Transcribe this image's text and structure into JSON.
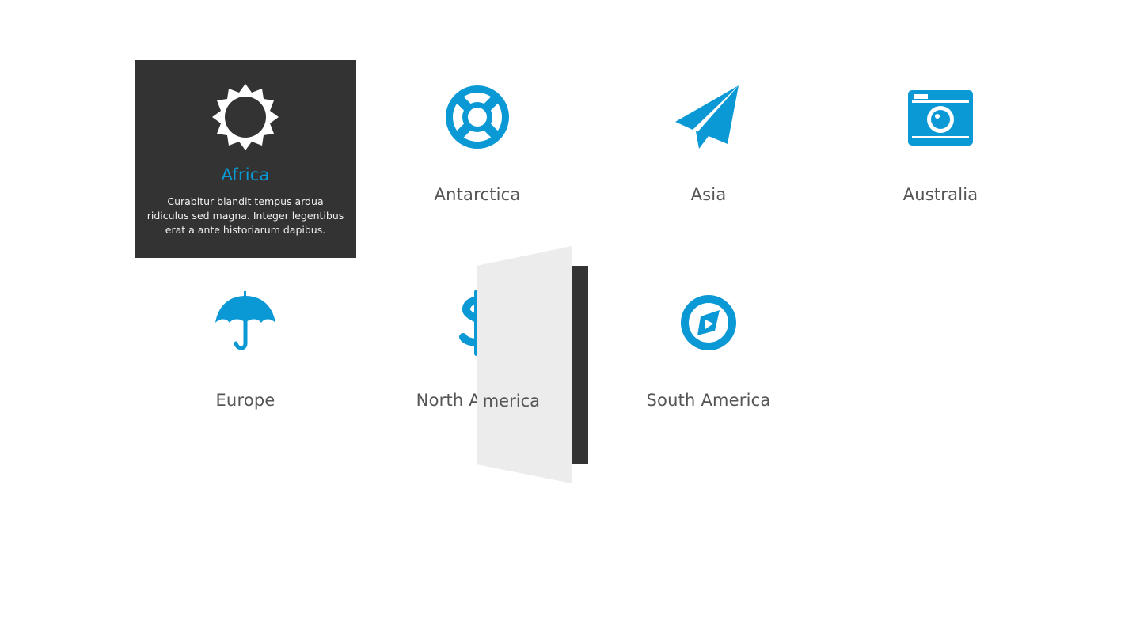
{
  "colors": {
    "accent": "#0b99d6",
    "active_bg": "#333333",
    "label": "#555555",
    "door": "#ececec"
  },
  "tiles": [
    {
      "id": "africa",
      "label": "Africa",
      "icon": "sun-icon",
      "description": "Curabitur blandit tempus ardua ridiculus sed magna. Integer legentibus erat a ante historiarum dapibus."
    },
    {
      "id": "antarctica",
      "label": "Antarctica",
      "icon": "lifebuoy-icon"
    },
    {
      "id": "asia",
      "label": "Asia",
      "icon": "paper-plane-icon"
    },
    {
      "id": "australia",
      "label": "Australia",
      "icon": "camera-icon"
    },
    {
      "id": "europe",
      "label": "Europe",
      "icon": "umbrella-icon"
    },
    {
      "id": "north-america",
      "label": "North America",
      "icon": "dollar-icon"
    },
    {
      "id": "south-america",
      "label": "South America",
      "icon": "compass-icon"
    }
  ],
  "flip_overlay": {
    "text_fragment": "merica"
  }
}
